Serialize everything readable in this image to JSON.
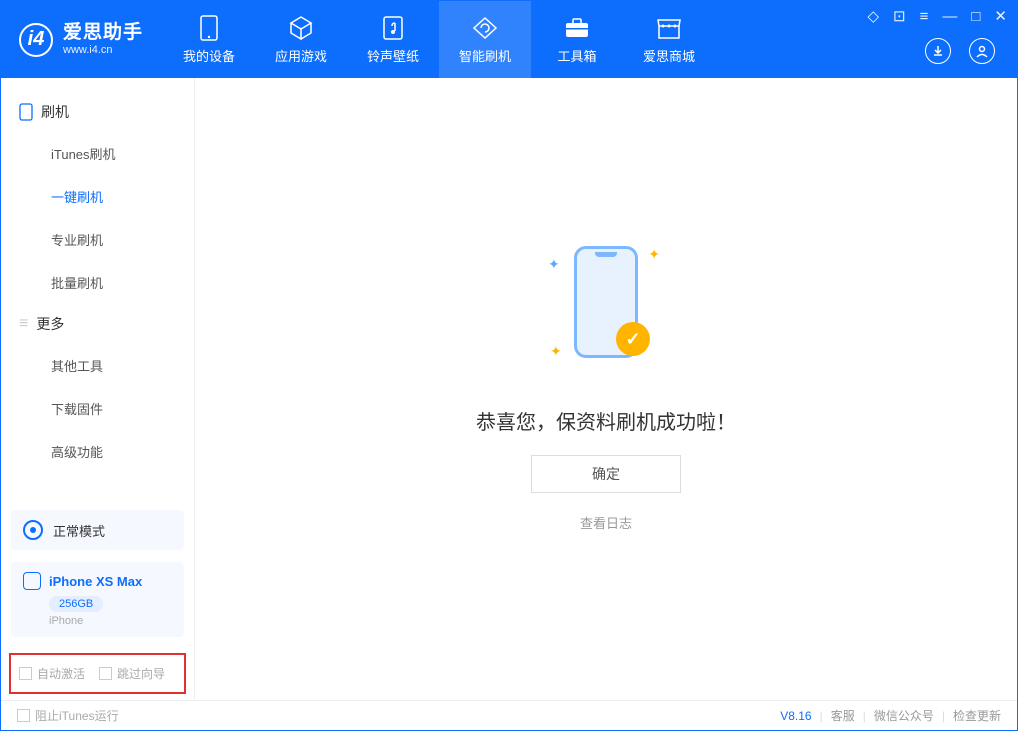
{
  "app": {
    "title": "爱思助手",
    "url": "www.i4.cn"
  },
  "nav": {
    "tabs": [
      {
        "label": "我的设备",
        "icon": "device"
      },
      {
        "label": "应用游戏",
        "icon": "cube"
      },
      {
        "label": "铃声壁纸",
        "icon": "music"
      },
      {
        "label": "智能刷机",
        "icon": "refresh",
        "active": true
      },
      {
        "label": "工具箱",
        "icon": "toolbox"
      },
      {
        "label": "爱思商城",
        "icon": "store"
      }
    ]
  },
  "sidebar": {
    "section1": {
      "title": "刷机",
      "items": [
        "iTunes刷机",
        "一键刷机",
        "专业刷机",
        "批量刷机"
      ],
      "active_index": 1
    },
    "section2": {
      "title": "更多",
      "items": [
        "其他工具",
        "下载固件",
        "高级功能"
      ]
    },
    "mode": {
      "label": "正常模式"
    },
    "device": {
      "name": "iPhone XS Max",
      "storage": "256GB",
      "type": "iPhone"
    },
    "checkboxes": {
      "auto_activate": "自动激活",
      "skip_guide": "跳过向导"
    }
  },
  "main": {
    "success_message": "恭喜您，保资料刷机成功啦！",
    "confirm_label": "确定",
    "view_log_label": "查看日志"
  },
  "statusbar": {
    "block_itunes": "阻止iTunes运行",
    "version": "V8.16",
    "links": [
      "客服",
      "微信公众号",
      "检查更新"
    ]
  }
}
